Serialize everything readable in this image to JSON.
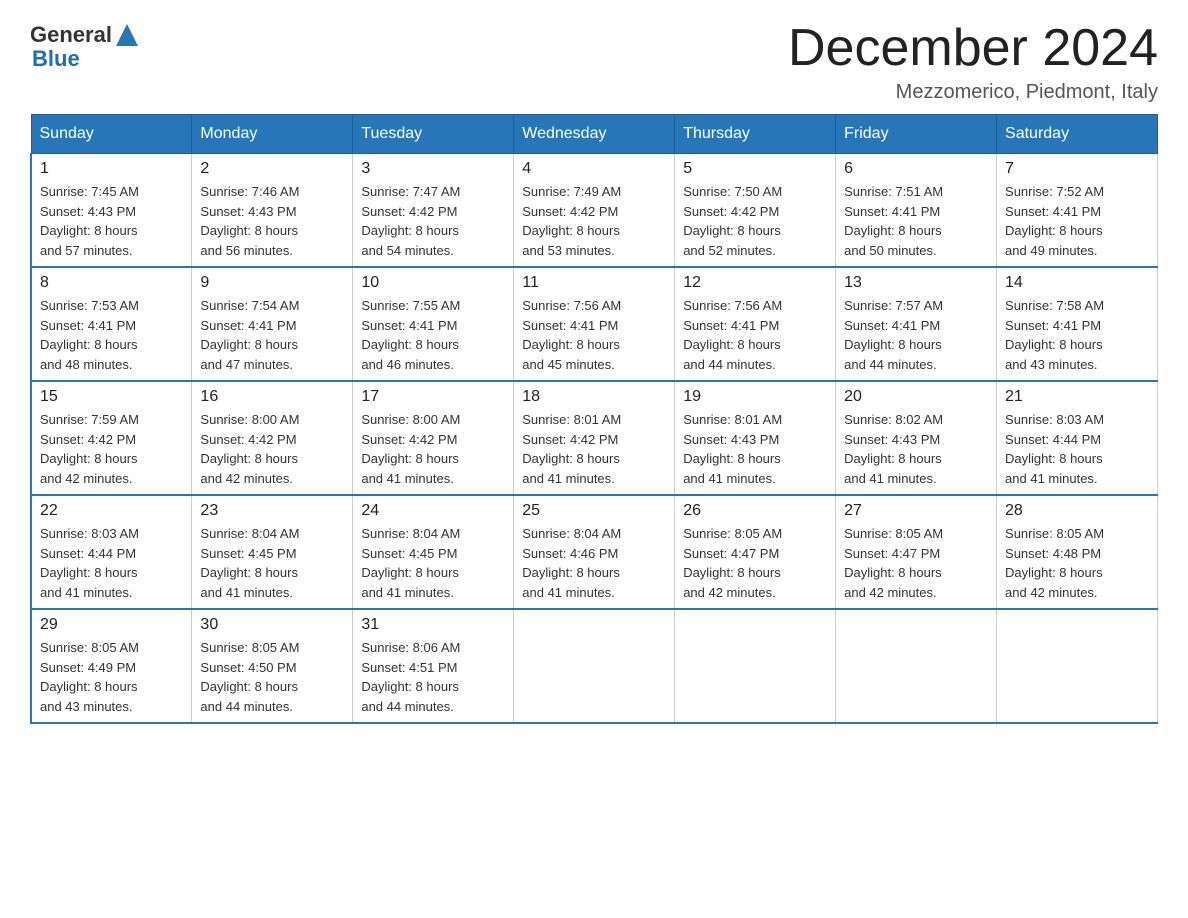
{
  "header": {
    "logo_general": "General",
    "logo_blue": "Blue",
    "month_year": "December 2024",
    "location": "Mezzomerico, Piedmont, Italy"
  },
  "weekdays": [
    "Sunday",
    "Monday",
    "Tuesday",
    "Wednesday",
    "Thursday",
    "Friday",
    "Saturday"
  ],
  "weeks": [
    [
      {
        "day": "1",
        "sunrise": "7:45 AM",
        "sunset": "4:43 PM",
        "daylight": "8 hours and 57 minutes."
      },
      {
        "day": "2",
        "sunrise": "7:46 AM",
        "sunset": "4:43 PM",
        "daylight": "8 hours and 56 minutes."
      },
      {
        "day": "3",
        "sunrise": "7:47 AM",
        "sunset": "4:42 PM",
        "daylight": "8 hours and 54 minutes."
      },
      {
        "day": "4",
        "sunrise": "7:49 AM",
        "sunset": "4:42 PM",
        "daylight": "8 hours and 53 minutes."
      },
      {
        "day": "5",
        "sunrise": "7:50 AM",
        "sunset": "4:42 PM",
        "daylight": "8 hours and 52 minutes."
      },
      {
        "day": "6",
        "sunrise": "7:51 AM",
        "sunset": "4:41 PM",
        "daylight": "8 hours and 50 minutes."
      },
      {
        "day": "7",
        "sunrise": "7:52 AM",
        "sunset": "4:41 PM",
        "daylight": "8 hours and 49 minutes."
      }
    ],
    [
      {
        "day": "8",
        "sunrise": "7:53 AM",
        "sunset": "4:41 PM",
        "daylight": "8 hours and 48 minutes."
      },
      {
        "day": "9",
        "sunrise": "7:54 AM",
        "sunset": "4:41 PM",
        "daylight": "8 hours and 47 minutes."
      },
      {
        "day": "10",
        "sunrise": "7:55 AM",
        "sunset": "4:41 PM",
        "daylight": "8 hours and 46 minutes."
      },
      {
        "day": "11",
        "sunrise": "7:56 AM",
        "sunset": "4:41 PM",
        "daylight": "8 hours and 45 minutes."
      },
      {
        "day": "12",
        "sunrise": "7:56 AM",
        "sunset": "4:41 PM",
        "daylight": "8 hours and 44 minutes."
      },
      {
        "day": "13",
        "sunrise": "7:57 AM",
        "sunset": "4:41 PM",
        "daylight": "8 hours and 44 minutes."
      },
      {
        "day": "14",
        "sunrise": "7:58 AM",
        "sunset": "4:41 PM",
        "daylight": "8 hours and 43 minutes."
      }
    ],
    [
      {
        "day": "15",
        "sunrise": "7:59 AM",
        "sunset": "4:42 PM",
        "daylight": "8 hours and 42 minutes."
      },
      {
        "day": "16",
        "sunrise": "8:00 AM",
        "sunset": "4:42 PM",
        "daylight": "8 hours and 42 minutes."
      },
      {
        "day": "17",
        "sunrise": "8:00 AM",
        "sunset": "4:42 PM",
        "daylight": "8 hours and 41 minutes."
      },
      {
        "day": "18",
        "sunrise": "8:01 AM",
        "sunset": "4:42 PM",
        "daylight": "8 hours and 41 minutes."
      },
      {
        "day": "19",
        "sunrise": "8:01 AM",
        "sunset": "4:43 PM",
        "daylight": "8 hours and 41 minutes."
      },
      {
        "day": "20",
        "sunrise": "8:02 AM",
        "sunset": "4:43 PM",
        "daylight": "8 hours and 41 minutes."
      },
      {
        "day": "21",
        "sunrise": "8:03 AM",
        "sunset": "4:44 PM",
        "daylight": "8 hours and 41 minutes."
      }
    ],
    [
      {
        "day": "22",
        "sunrise": "8:03 AM",
        "sunset": "4:44 PM",
        "daylight": "8 hours and 41 minutes."
      },
      {
        "day": "23",
        "sunrise": "8:04 AM",
        "sunset": "4:45 PM",
        "daylight": "8 hours and 41 minutes."
      },
      {
        "day": "24",
        "sunrise": "8:04 AM",
        "sunset": "4:45 PM",
        "daylight": "8 hours and 41 minutes."
      },
      {
        "day": "25",
        "sunrise": "8:04 AM",
        "sunset": "4:46 PM",
        "daylight": "8 hours and 41 minutes."
      },
      {
        "day": "26",
        "sunrise": "8:05 AM",
        "sunset": "4:47 PM",
        "daylight": "8 hours and 42 minutes."
      },
      {
        "day": "27",
        "sunrise": "8:05 AM",
        "sunset": "4:47 PM",
        "daylight": "8 hours and 42 minutes."
      },
      {
        "day": "28",
        "sunrise": "8:05 AM",
        "sunset": "4:48 PM",
        "daylight": "8 hours and 42 minutes."
      }
    ],
    [
      {
        "day": "29",
        "sunrise": "8:05 AM",
        "sunset": "4:49 PM",
        "daylight": "8 hours and 43 minutes."
      },
      {
        "day": "30",
        "sunrise": "8:05 AM",
        "sunset": "4:50 PM",
        "daylight": "8 hours and 44 minutes."
      },
      {
        "day": "31",
        "sunrise": "8:06 AM",
        "sunset": "4:51 PM",
        "daylight": "8 hours and 44 minutes."
      },
      null,
      null,
      null,
      null
    ]
  ],
  "labels": {
    "sunrise_prefix": "Sunrise: ",
    "sunset_prefix": "Sunset: ",
    "daylight_prefix": "Daylight: "
  }
}
